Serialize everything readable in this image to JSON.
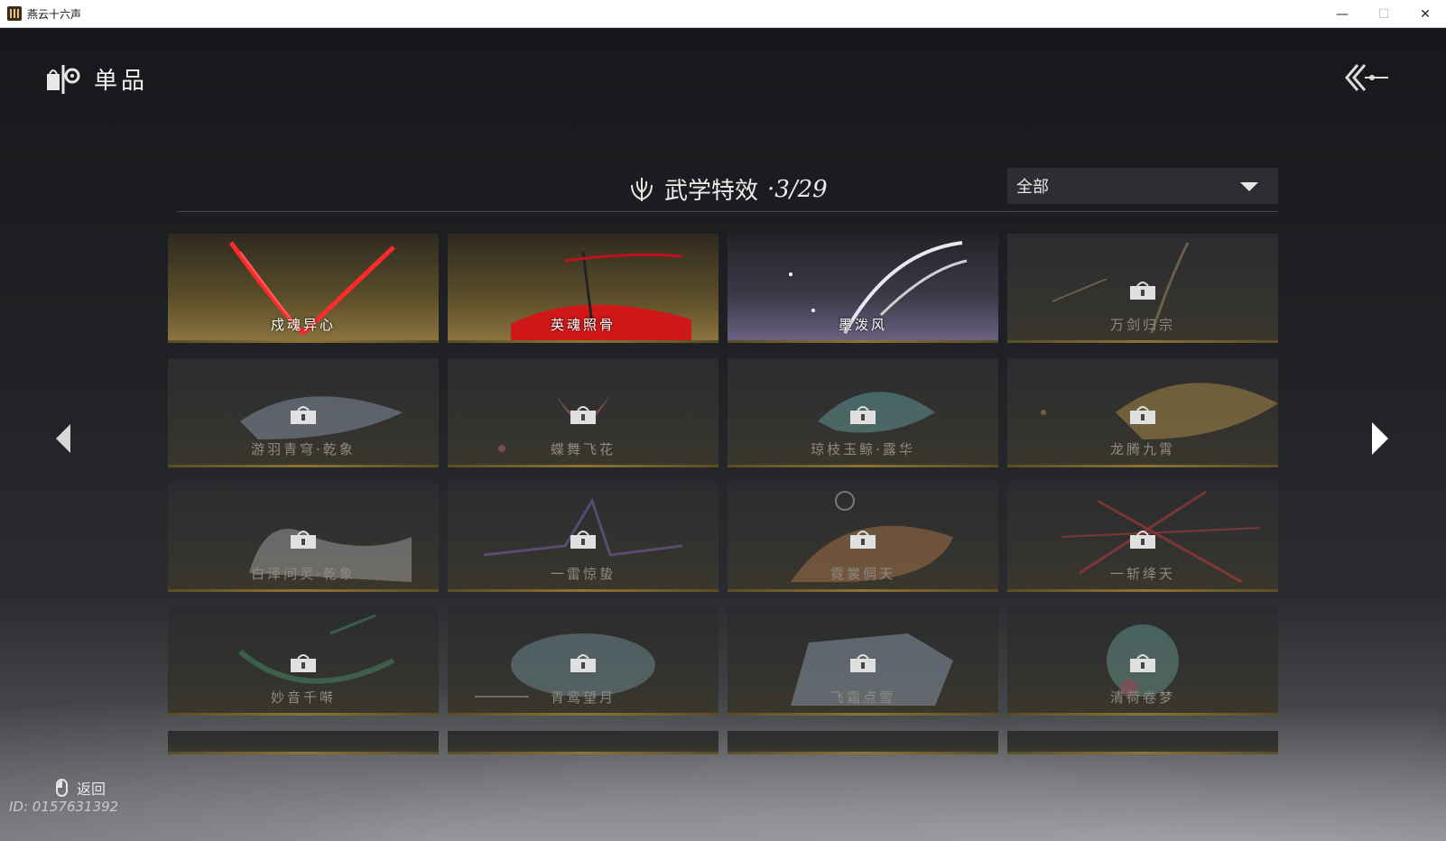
{
  "window": {
    "title": "燕云十六声",
    "controls": {
      "minimize": "—",
      "maximize": "☐",
      "close": "✕"
    }
  },
  "header": {
    "title": "单品",
    "icon": "item-shop-icon",
    "back_icon": "back-arrow-icon"
  },
  "section": {
    "title": "武学特效",
    "count": "·3/29",
    "icon": "lotus-emblem-icon",
    "filter": {
      "selected": "全部"
    }
  },
  "effects": [
    {
      "name": "戍魂异心",
      "locked": false,
      "theme": "gold"
    },
    {
      "name": "英魂照骨",
      "locked": false,
      "theme": "gold"
    },
    {
      "name": "墨泼风",
      "locked": false,
      "theme": "purple"
    },
    {
      "name": "万剑归宗",
      "locked": true
    },
    {
      "name": "游羽青穹·乾象",
      "locked": true
    },
    {
      "name": "蝶舞飞花",
      "locked": true
    },
    {
      "name": "琼枝玉鲸·露华",
      "locked": true
    },
    {
      "name": "龙腾九霄",
      "locked": true
    },
    {
      "name": "白泽问灵·乾象",
      "locked": true
    },
    {
      "name": "一雷惊蛰",
      "locked": true
    },
    {
      "name": "霓裳侗天",
      "locked": true
    },
    {
      "name": "一斩绛天",
      "locked": true
    },
    {
      "name": "妙音千啭",
      "locked": true
    },
    {
      "name": "青鸾望月",
      "locked": true
    },
    {
      "name": "飞霜点雪",
      "locked": true
    },
    {
      "name": "清荷卷梦",
      "locked": true
    }
  ],
  "navigation": {
    "prev_icon": "arrow-left-icon",
    "next_icon": "arrow-right-icon"
  },
  "footer": {
    "back_hint": "返回",
    "player_id": "ID: 0157631392"
  },
  "colors": {
    "gold_trim": "#8a7434",
    "red_effect": "#e0202a",
    "bg_dark": "#1e1f22"
  }
}
